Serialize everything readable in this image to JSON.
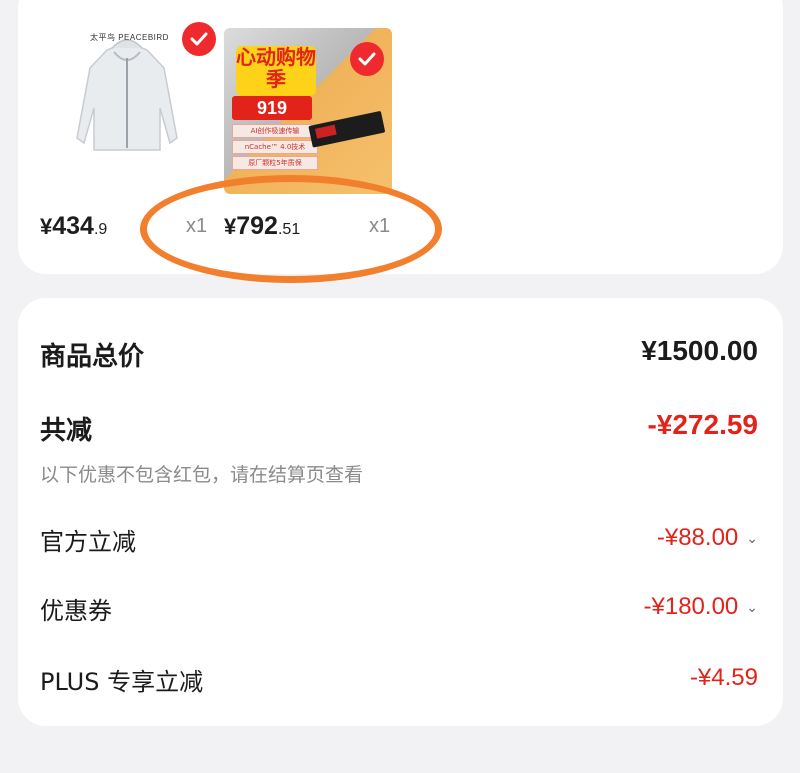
{
  "products": [
    {
      "brand": "太平鸟 PEACEBIRD",
      "price_symbol": "¥",
      "price_int": "434",
      "price_dec": ".9",
      "qty": "x1",
      "selected": true,
      "image_icon": "jacket-image"
    },
    {
      "promo_title": "心动购物季",
      "promo_number": "919",
      "promo_lines": [
        "AI创作极速传输",
        "nCache™ 4.0技术",
        "原厂颗粒5年质保"
      ],
      "price_symbol": "¥",
      "price_int": "792",
      "price_dec": ".51",
      "qty": "x1",
      "selected": true,
      "image_icon": "ssd-promo-image"
    }
  ],
  "summary": {
    "total_label": "商品总价",
    "total_value": "¥1500.00",
    "discount_label": "共减",
    "discount_value": "-¥272.59",
    "note": "以下优惠不包含红包，请在结算页查看",
    "items": [
      {
        "label": "官方立减",
        "value": "-¥88.00",
        "expandable": true
      },
      {
        "label": "优惠券",
        "value": "-¥180.00",
        "expandable": true
      },
      {
        "label": "PLUS 专享立减",
        "value": "-¥4.59",
        "expandable": false
      }
    ]
  },
  "colors": {
    "accent_red": "#e2231a",
    "annotation_orange": "#f17f2e",
    "background": "#f2f2f4"
  }
}
